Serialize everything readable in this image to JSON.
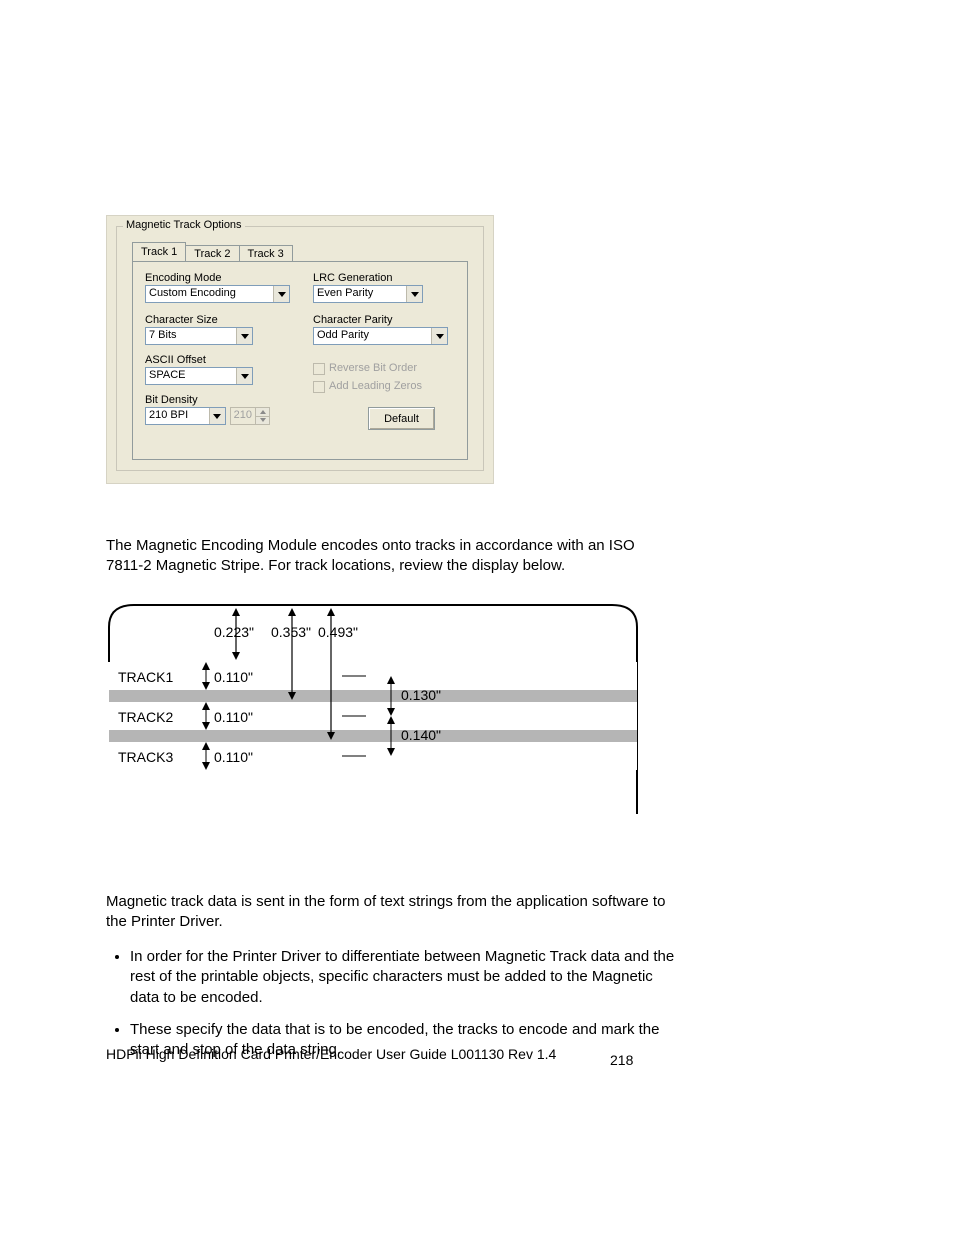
{
  "dialog": {
    "group_title": "Magnetic Track Options",
    "tabs": [
      "Track 1",
      "Track 2",
      "Track 3"
    ],
    "left": {
      "encoding_mode_label": "Encoding Mode",
      "encoding_mode_value": "Custom Encoding",
      "character_size_label": "Character Size",
      "character_size_value": "7 Bits",
      "ascii_offset_label": "ASCII Offset",
      "ascii_offset_value": "SPACE",
      "bit_density_label": "Bit Density",
      "bit_density_value": "210 BPI",
      "bit_density_spin": "210"
    },
    "right": {
      "lrc_label": "LRC Generation",
      "lrc_value": "Even Parity",
      "char_parity_label": "Character Parity",
      "char_parity_value": "Odd Parity",
      "reverse_label": "Reverse Bit Order",
      "leading_zeros_label": "Add Leading Zeros",
      "default_btn": "Default"
    }
  },
  "body": {
    "p1": "The Magnetic Encoding Module encodes onto tracks in accordance with an ISO 7811-2 Magnetic Stripe. For track locations, review the display below.",
    "p2": "Magnetic track data is sent in the form of text strings from the application software to the Printer Driver.",
    "bullet1": "In order for the Printer Driver to differentiate between Magnetic Track data and the rest of the printable objects, specific characters must be added to the Magnetic data to be encoded.",
    "bullet2": "These specify the data that is to be encoded, the tracks to encode and mark the start and stop of the data string."
  },
  "figure": {
    "top_labels": [
      "0.223\"",
      "0.353\"",
      "0.493\""
    ],
    "tracks": [
      {
        "name": "TRACK1",
        "height": "0.110\""
      },
      {
        "name": "TRACK2",
        "height": "0.110\""
      },
      {
        "name": "TRACK3",
        "height": "0.110\""
      }
    ],
    "gaps": [
      "0.130\"",
      "0.140\""
    ]
  },
  "footer": {
    "left": "HDPii High Definition Card Printer/Encoder User Guide    L001130 Rev 1.4",
    "page": "218"
  }
}
